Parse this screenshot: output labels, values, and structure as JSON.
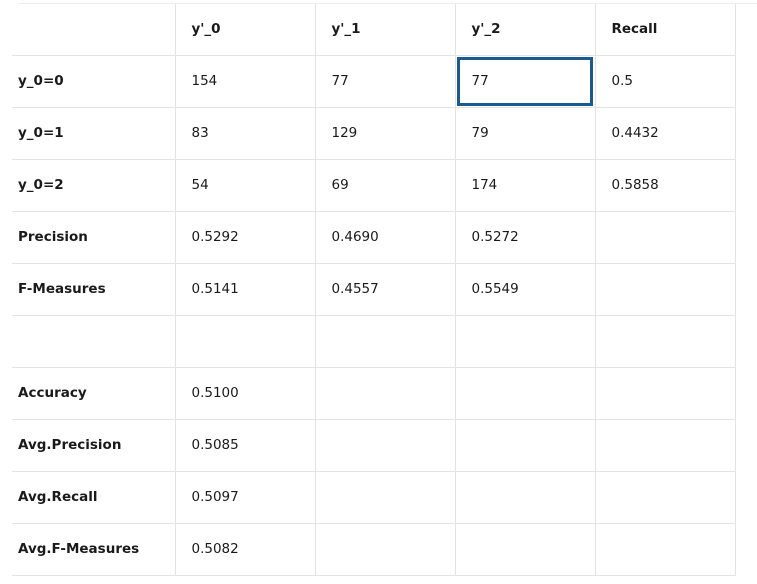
{
  "table": {
    "headers": [
      "",
      "y'_0",
      "y'_1",
      "y'_2",
      "Recall"
    ],
    "rows": [
      {
        "label": "y_0=0",
        "cells": [
          "154",
          "77",
          "77",
          "0.5"
        ]
      },
      {
        "label": "y_0=1",
        "cells": [
          "83",
          "129",
          "79",
          "0.4432"
        ]
      },
      {
        "label": "y_0=2",
        "cells": [
          "54",
          "69",
          "174",
          "0.5858"
        ]
      },
      {
        "label": "Precision",
        "cells": [
          "0.5292",
          "0.4690",
          "0.5272",
          ""
        ]
      },
      {
        "label": "F-Measures",
        "cells": [
          "0.5141",
          "0.4557",
          "0.5549",
          ""
        ]
      },
      {
        "label": "",
        "cells": [
          "",
          "",
          "",
          ""
        ]
      },
      {
        "label": "Accuracy",
        "cells": [
          "0.5100",
          "",
          "",
          ""
        ]
      },
      {
        "label": "Avg.Precision",
        "cells": [
          "0.5085",
          "",
          "",
          ""
        ]
      },
      {
        "label": "Avg.Recall",
        "cells": [
          "0.5097",
          "",
          "",
          ""
        ]
      },
      {
        "label": "Avg.F-Measures",
        "cells": [
          "0.5082",
          "",
          "",
          ""
        ]
      }
    ],
    "selected_cell": {
      "row": 0,
      "col": 2
    },
    "selection_color": "#1a5a8e"
  }
}
